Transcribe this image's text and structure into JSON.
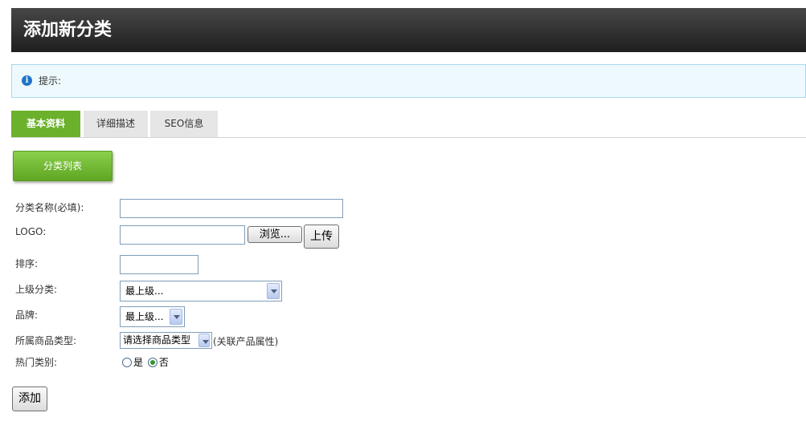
{
  "page": {
    "title": "添加新分类"
  },
  "tip": {
    "text": "提示:",
    "icon": "info-icon"
  },
  "tabs": [
    {
      "label": "基本资料",
      "active": true
    },
    {
      "label": "详细描述",
      "active": false
    },
    {
      "label": "SEO信息",
      "active": false
    }
  ],
  "list_button": {
    "label": "分类列表"
  },
  "form": {
    "name": {
      "label": "分类名称(必填):",
      "value": ""
    },
    "logo": {
      "label": "LOGO:",
      "value": "",
      "browse_label": "浏览...",
      "upload_label": "上传"
    },
    "sort": {
      "label": "排序:",
      "value": ""
    },
    "parent": {
      "label": "上级分类:",
      "selected": "最上级..."
    },
    "brand": {
      "label": "品牌:",
      "selected": "最上级..."
    },
    "product_type": {
      "label": "所属商品类型:",
      "selected": "请选择商品类型",
      "note": "(关联产品属性)"
    },
    "hot": {
      "label": "热门类别:",
      "options": [
        {
          "label": "是",
          "checked": false
        },
        {
          "label": "否",
          "checked": true
        }
      ]
    },
    "submit_label": "添加"
  },
  "colors": {
    "header_bg": "#2b2b2b",
    "accent_green": "#6bb12b",
    "tip_bg": "#eef9fe"
  }
}
